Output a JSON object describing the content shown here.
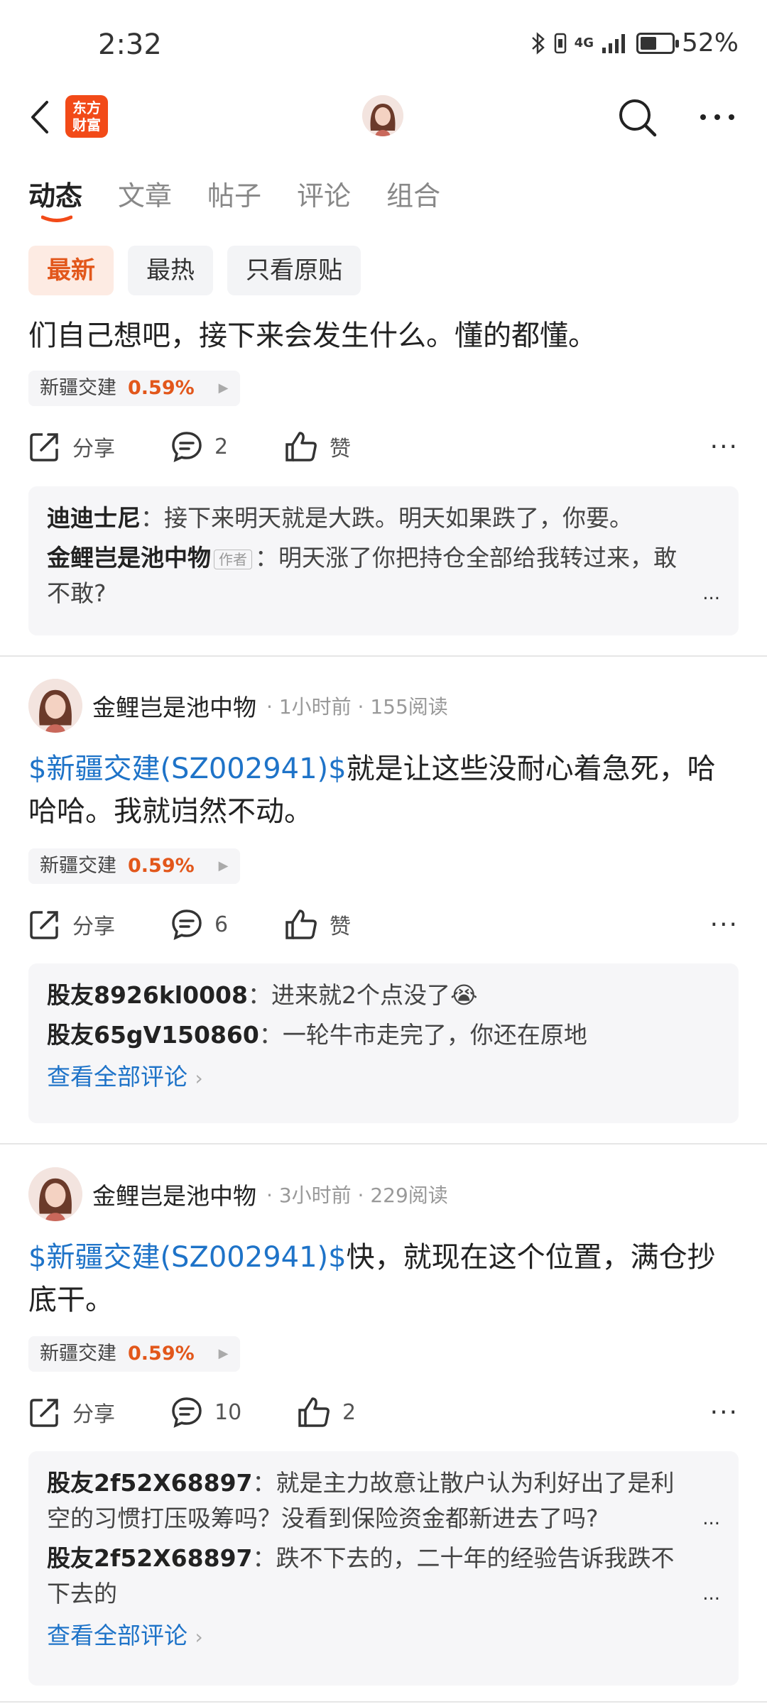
{
  "status_bar": {
    "time": "2:32",
    "network": "4G",
    "battery_percent": "52%",
    "battery_level": 0.52
  },
  "header": {
    "logo_text_line1": "东方",
    "logo_text_line2": "财富",
    "back_icon": "chevron-left-icon",
    "search_icon": "search-icon",
    "more_icon": "more-horizontal-icon"
  },
  "tabs": [
    {
      "label": "动态",
      "active": true
    },
    {
      "label": "文章",
      "active": false
    },
    {
      "label": "帖子",
      "active": false
    },
    {
      "label": "评论",
      "active": false
    },
    {
      "label": "组合",
      "active": false
    }
  ],
  "filters": [
    {
      "label": "最新",
      "active": true
    },
    {
      "label": "最热",
      "active": false
    },
    {
      "label": "只看原贴",
      "active": false
    }
  ],
  "labels": {
    "share": "分享",
    "like": "赞",
    "view_all_comments": "查看全部评论",
    "author_badge": "作者"
  },
  "colors": {
    "accent": "#e2571b",
    "link": "#1e73c8",
    "logo": "#f24a18"
  },
  "post1": {
    "text": "们自己想吧，接下来会发生什么。懂的都懂。",
    "stock_name": "新疆交建",
    "stock_change": "0.59%",
    "comments_count": "2",
    "likes": "赞",
    "comments": [
      {
        "author": "迪迪士尼",
        "text": "接下来明天就是大跌。明天如果跌了，你要。"
      },
      {
        "author": "金鲤岂是池中物",
        "text": "明天涨了你把持仓全部给我转过来，敢不敢?"
      }
    ]
  },
  "post2": {
    "author": "金鲤岂是池中物",
    "time": "1小时前",
    "reads": "155阅读",
    "stock_link": "$新疆交建(SZ002941)$",
    "text": "就是让这些没耐心着急死，哈哈哈。我就岿然不动。",
    "stock_name": "新疆交建",
    "stock_change": "0.59%",
    "comments_count": "6",
    "likes": "赞",
    "comments": [
      {
        "author": "股友8926kl0008",
        "text": "进来就2个点没了😭"
      },
      {
        "author": "股友65gV150860",
        "text": "一轮牛市走完了，你还在原地"
      }
    ]
  },
  "post3": {
    "author": "金鲤岂是池中物",
    "time": "3小时前",
    "reads": "229阅读",
    "stock_link": "$新疆交建(SZ002941)$",
    "text": "快，就现在这个位置，满仓抄底干。",
    "stock_name": "新疆交建",
    "stock_change": "0.59%",
    "comments_count": "10",
    "likes": "2",
    "comments": [
      {
        "author": "股友2f52X68897",
        "text": "就是主力故意让散户认为利好出了是利空的习惯打压吸筹吗？没看到保险资金都新进去了吗?"
      },
      {
        "author": "股友2f52X68897",
        "text": "跌不下去的，二十年的经验告诉我跌不下去的"
      }
    ]
  }
}
